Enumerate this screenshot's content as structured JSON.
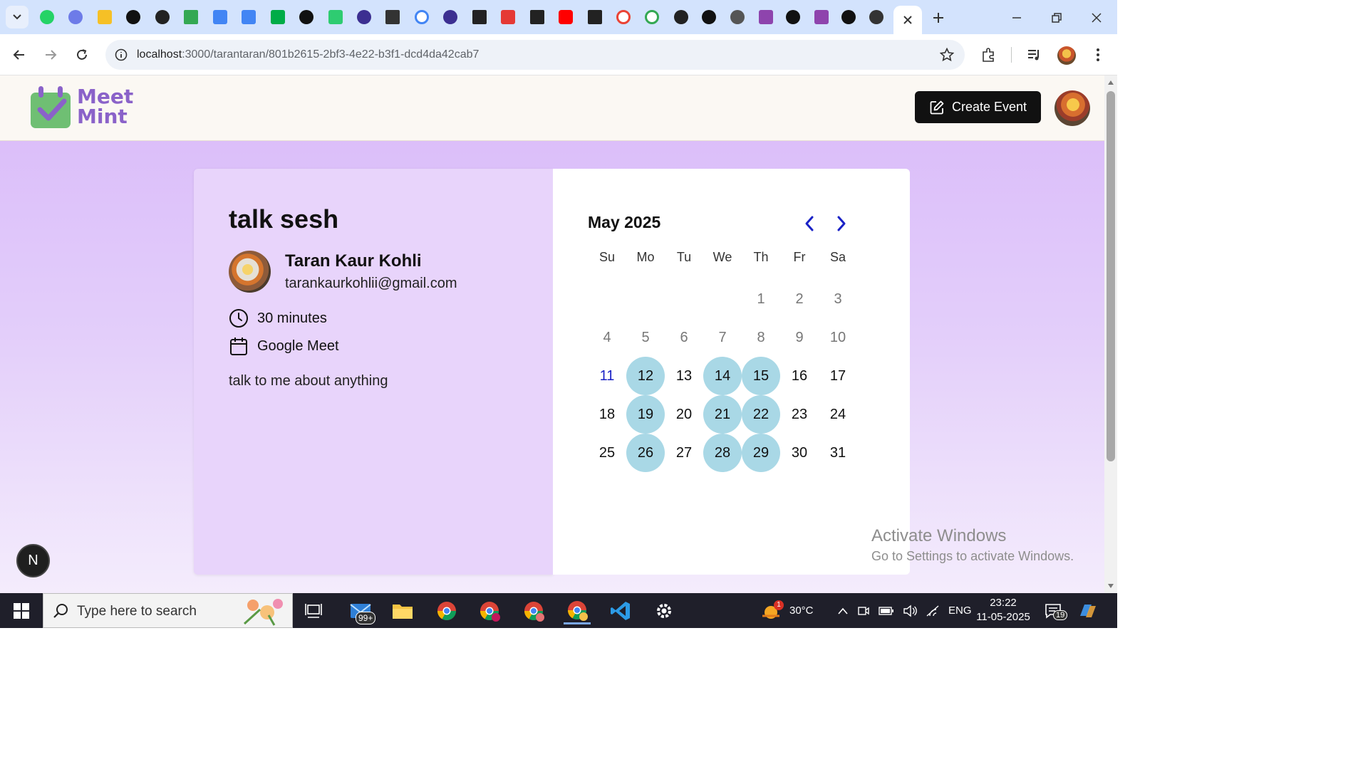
{
  "browser": {
    "url_host": "localhost",
    "url_path": ":3000/tarantaran/801b2615-2bf3-4e22-b3f1-dcd4da42cab7"
  },
  "header": {
    "logo_line1": "Meet",
    "logo_line2": "Mint",
    "create_label": "Create Event"
  },
  "event": {
    "title": "talk sesh",
    "host_name": "Taran Kaur Kohli",
    "host_email": "tarankaurkohlii@gmail.com",
    "duration": "30 minutes",
    "platform": "Google Meet",
    "description": "talk to me about anything"
  },
  "calendar": {
    "month_label": "May 2025",
    "weekdays": [
      "Su",
      "Mo",
      "Tu",
      "We",
      "Th",
      "Fr",
      "Sa"
    ],
    "first_weekday": 4,
    "days_in_month": 31,
    "today": 11,
    "available_days": [
      12,
      14,
      15,
      19,
      21,
      22,
      26,
      28,
      29
    ]
  },
  "overlay": {
    "n_badge": "N",
    "watermark_title": "Activate Windows",
    "watermark_sub": "Go to Settings to activate Windows."
  },
  "taskbar": {
    "search_placeholder": "Type here to search",
    "mail_badge": "99+",
    "weather_temp": "30°C",
    "weather_badge": "1",
    "lang": "ENG",
    "time": "23:22",
    "date": "11-05-2025",
    "notif_count": "19"
  },
  "colors": {
    "accent": "#8a62c9",
    "available": "#a9d8e6",
    "today": "#1a22c6",
    "nav_arrow": "#1a22c6"
  }
}
